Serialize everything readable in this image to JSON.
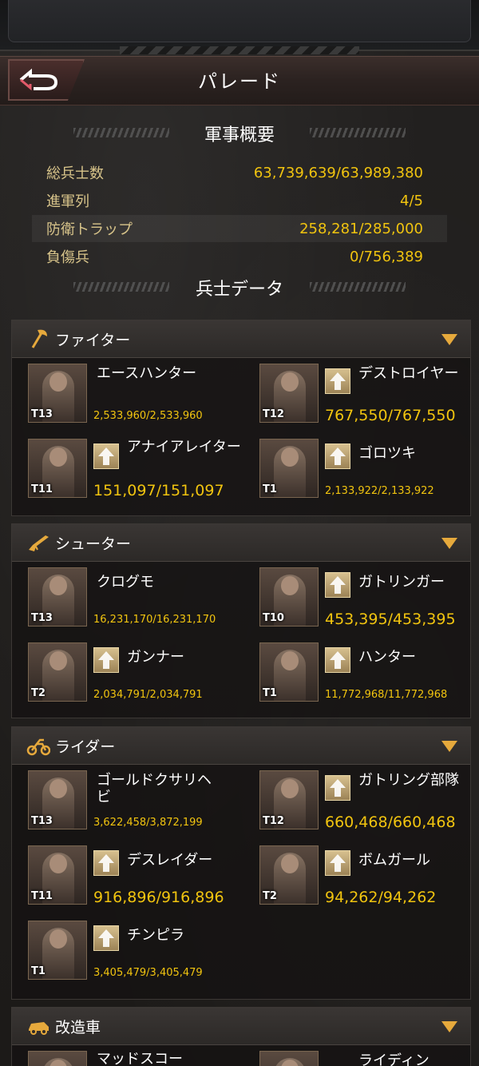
{
  "header": {
    "title": "パレード"
  },
  "overview": {
    "heading": "軍事概要",
    "rows": [
      {
        "label": "総兵士数",
        "value": "63,739,639/63,989,380"
      },
      {
        "label": "進軍列",
        "value": "4/5"
      },
      {
        "label": "防衛トラップ",
        "value": "258,281/285,000"
      },
      {
        "label": "負傷兵",
        "value": "0/756,389"
      }
    ]
  },
  "soldier_data": {
    "heading": "兵士データ"
  },
  "categories": [
    {
      "name": "ファイター",
      "icon": "axe-icon",
      "units": [
        {
          "name": "エースハンター",
          "tier": "T13",
          "count": "2,533,960/2,533,960"
        },
        {
          "name": "デストロイヤー",
          "tier": "T12",
          "count": "767,550/767,550"
        },
        {
          "name": "アナイアレイター",
          "tier": "T11",
          "count": "151,097/151,097"
        },
        {
          "name": "ゴロツキ",
          "tier": "T1",
          "count": "2,133,922/2,133,922"
        }
      ]
    },
    {
      "name": "シューター",
      "icon": "rifle-icon",
      "units": [
        {
          "name": "クログモ",
          "tier": "T13",
          "count": "16,231,170/16,231,170"
        },
        {
          "name": "ガトリンガー",
          "tier": "T10",
          "count": "453,395/453,395"
        },
        {
          "name": "ガンナー",
          "tier": "T2",
          "count": "2,034,791/2,034,791"
        },
        {
          "name": "ハンター",
          "tier": "T1",
          "count": "11,772,968/11,772,968"
        }
      ]
    },
    {
      "name": "ライダー",
      "icon": "motorcycle-icon",
      "units": [
        {
          "name": "ゴールドクサリヘビ",
          "tier": "T13",
          "count": "3,622,458/3,872,199"
        },
        {
          "name": "ガトリング部隊",
          "tier": "T12",
          "count": "660,468/660,468"
        },
        {
          "name": "デスレイダー",
          "tier": "T11",
          "count": "916,896/916,896"
        },
        {
          "name": "ボムガール",
          "tier": "T2",
          "count": "94,262/94,262"
        },
        {
          "name": "チンピラ",
          "tier": "T1",
          "count": "3,405,479/3,405,479"
        }
      ]
    },
    {
      "name": "改造車",
      "icon": "car-icon",
      "units": [
        {
          "name": "マッドスコー"
        },
        {
          "name": "ライディン"
        }
      ]
    }
  ],
  "colors": {
    "accent": "#f1c40f",
    "label": "#d8c48a",
    "arrow": "#e6a93c"
  }
}
